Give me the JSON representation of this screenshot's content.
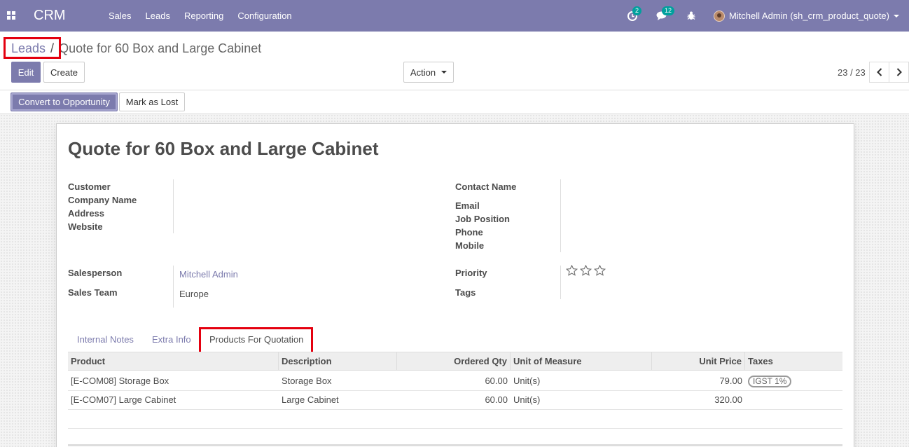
{
  "navbar": {
    "brand": "CRM",
    "menu": [
      "Sales",
      "Leads",
      "Reporting",
      "Configuration"
    ],
    "activity_count": "2",
    "message_count": "12",
    "user": "Mitchell Admin (sh_crm_product_quote)"
  },
  "breadcrumb": {
    "parent": "Leads",
    "separator": "/",
    "current": "Quote for 60 Box and Large Cabinet"
  },
  "buttons": {
    "edit": "Edit",
    "create": "Create",
    "action": "Action",
    "convert": "Convert to Opportunity",
    "mark_lost": "Mark as Lost"
  },
  "pager": {
    "value": "23 / 23"
  },
  "record": {
    "title": "Quote for 60 Box and Large Cabinet",
    "labels": {
      "customer": "Customer",
      "company_name": "Company Name",
      "address": "Address",
      "website": "Website",
      "contact_name": "Contact Name",
      "email": "Email",
      "job_position": "Job Position",
      "phone": "Phone",
      "mobile": "Mobile",
      "salesperson": "Salesperson",
      "sales_team": "Sales Team",
      "priority": "Priority",
      "tags": "Tags"
    },
    "salesperson": "Mitchell Admin",
    "sales_team": "Europe",
    "priority_stars": 0
  },
  "tabs": [
    "Internal Notes",
    "Extra Info",
    "Products For Quotation"
  ],
  "active_tab": "Products For Quotation",
  "table": {
    "headers": [
      "Product",
      "Description",
      "Ordered Qty",
      "Unit of Measure",
      "Unit Price",
      "Taxes"
    ],
    "rows": [
      {
        "product": "[E-COM08] Storage Box",
        "description": "Storage Box",
        "qty": "60.00",
        "uom": "Unit(s)",
        "price": "79.00",
        "tax": "IGST 1%"
      },
      {
        "product": "[E-COM07] Large Cabinet",
        "description": "Large Cabinet",
        "qty": "60.00",
        "uom": "Unit(s)",
        "price": "320.00",
        "tax": ""
      }
    ]
  },
  "colors": {
    "brand": "#7c7bad",
    "highlight": "#e4000f",
    "badge": "#00a09d"
  }
}
